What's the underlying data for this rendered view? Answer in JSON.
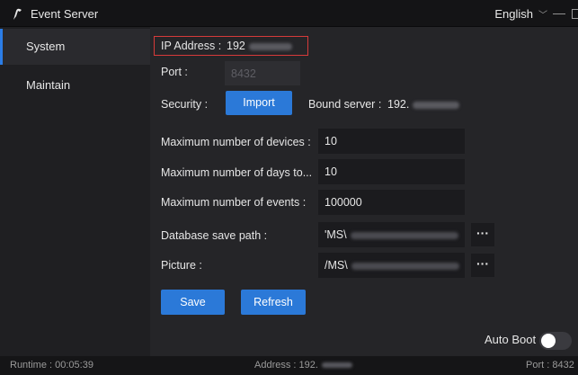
{
  "window": {
    "title": "Event Server",
    "language": "English",
    "chevron_icon": "chevron-down-icon",
    "minimize_icon": "minimize-icon",
    "maximize_icon": "maximize-icon"
  },
  "sidebar": {
    "items": [
      {
        "label": "System",
        "active": true
      },
      {
        "label": "Maintain",
        "active": false
      }
    ]
  },
  "form": {
    "ip_label": "IP Address :",
    "ip_value": "192",
    "port_label": "Port :",
    "port_value": "8432",
    "security_label": "Security :",
    "import_label": "Import",
    "bound_label": "Bound server :",
    "bound_value": "192.",
    "max_devices_label": "Maximum number of devices :",
    "max_devices_value": "10",
    "max_days_label": "Maximum number of days to...",
    "max_days_value": "10",
    "max_events_label": "Maximum number of events :",
    "max_events_value": "100000",
    "db_path_label": "Database save path :",
    "db_path_value": "'MS\\",
    "picture_label": "Picture :",
    "picture_value": "/MS\\",
    "browse_label": "···",
    "save_label": "Save",
    "refresh_label": "Refresh",
    "auto_boot_label": "Auto Boot",
    "auto_boot_on": false
  },
  "statusbar": {
    "runtime_label": "Runtime :",
    "runtime_value": "00:05:39",
    "address_label": "Address :",
    "address_value": "192.",
    "port_label": "Port :",
    "port_value": "8432"
  },
  "colors": {
    "accent": "#2b79d8",
    "highlight": "#d63a3a"
  }
}
